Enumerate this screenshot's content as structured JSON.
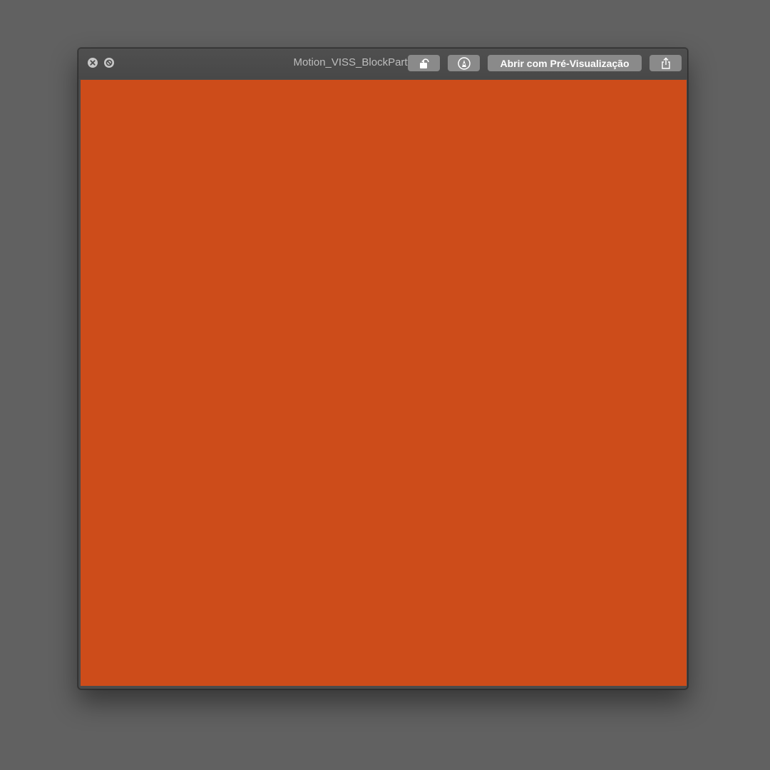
{
  "window": {
    "title": "Motion_VISS_BlockParty.gif"
  },
  "titlebar": {
    "close_icon": "close-icon",
    "fullscreen_icon": "fullscreen-icon"
  },
  "toolbar": {
    "rotate_icon": "rotate-left-icon",
    "markup_icon": "markup-icon",
    "open_with_label": "Abrir com Pré-Visualização",
    "share_icon": "share-icon"
  },
  "preview": {
    "color": "#cd4c1a"
  }
}
